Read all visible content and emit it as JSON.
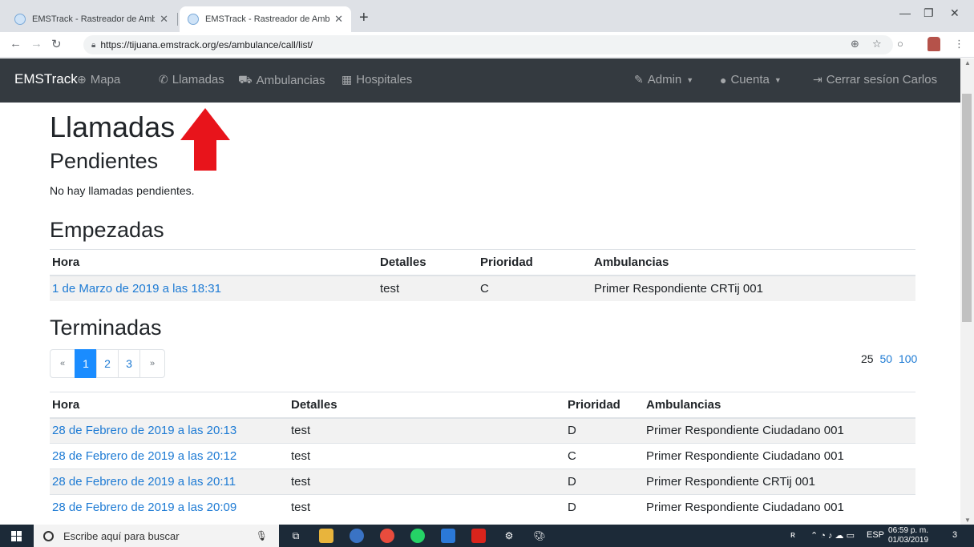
{
  "browser": {
    "tabs": [
      {
        "title": "EMSTrack - Rastreador de Ambul",
        "active": false
      },
      {
        "title": "EMSTrack - Rastreador de Ambul",
        "active": true
      }
    ],
    "new_tab": "+",
    "url": "https://tijuana.emstrack.org/es/ambulance/call/list/"
  },
  "navbar": {
    "brand": "EMSTrack",
    "items": [
      {
        "label": "Mapa",
        "icon": "globe-icon"
      },
      {
        "label": "Llamadas",
        "icon": "phone-icon"
      },
      {
        "label": "Ambulancias",
        "icon": "ambulance-icon"
      },
      {
        "label": "Hospitales",
        "icon": "hospital-icon"
      }
    ],
    "admin": "Admin",
    "account": "Cuenta",
    "logout": "Cerrar sesíon Carlos"
  },
  "page": {
    "title": "Llamadas",
    "pending": {
      "heading": "Pendientes",
      "empty": "No hay llamadas pendientes."
    },
    "started": {
      "heading": "Empezadas",
      "columns": [
        "Hora",
        "Detalles",
        "Prioridad",
        "Ambulancias"
      ],
      "rows": [
        {
          "time": "1 de Marzo de 2019 a las 18:31",
          "details": "test",
          "priority": "C",
          "ambulances": "Primer Respondiente CRTij 001"
        }
      ]
    },
    "finished": {
      "heading": "Terminadas",
      "pagination": {
        "prev": "«",
        "pages": [
          "1",
          "2",
          "3"
        ],
        "next": "»",
        "current": "1"
      },
      "page_sizes": [
        "25",
        "50",
        "100"
      ],
      "columns": [
        "Hora",
        "Detalles",
        "Prioridad",
        "Ambulancias"
      ],
      "rows": [
        {
          "time": "28 de Febrero de 2019 a las 20:13",
          "details": "test",
          "priority": "D",
          "ambulances": "Primer Respondiente Ciudadano 001"
        },
        {
          "time": "28 de Febrero de 2019 a las 20:12",
          "details": "test",
          "priority": "C",
          "ambulances": "Primer Respondiente Ciudadano 001"
        },
        {
          "time": "28 de Febrero de 2019 a las 20:11",
          "details": "test",
          "priority": "D",
          "ambulances": "Primer Respondiente CRTij 001"
        },
        {
          "time": "28 de Febrero de 2019 a las 20:09",
          "details": "test",
          "priority": "D",
          "ambulances": "Primer Respondiente Ciudadano 001"
        }
      ]
    }
  },
  "taskbar": {
    "search_placeholder": "Escribe aquí para buscar",
    "language": "ESP",
    "time": "06:59 p. m.",
    "date": "01/03/2019",
    "notifications": "3"
  },
  "colors": {
    "navbar": "#343a40",
    "link": "#1e7bd4",
    "active_page": "#1a8cff",
    "arrow": "#e8141b"
  }
}
